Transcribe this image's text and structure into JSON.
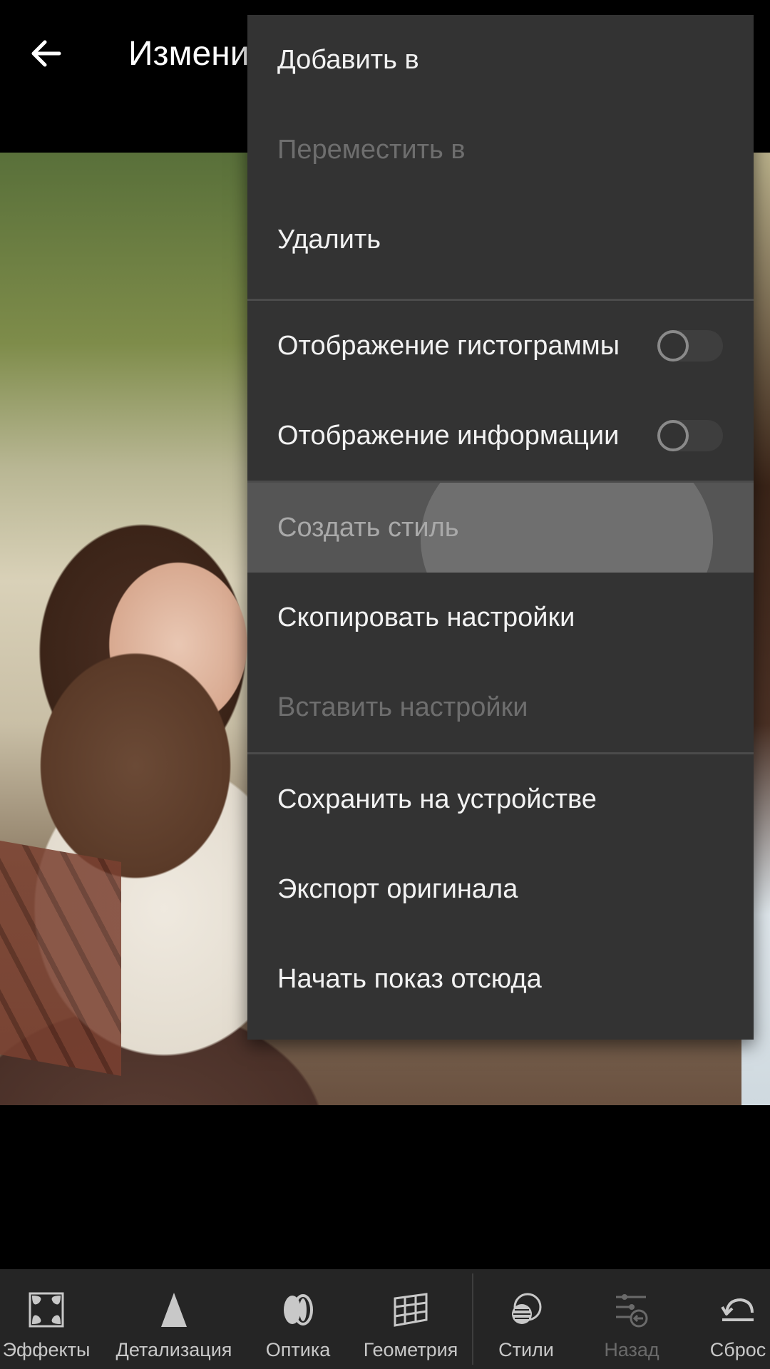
{
  "header": {
    "title": "Изменить"
  },
  "menu": {
    "items": [
      {
        "label": "Добавить в",
        "enabled": true
      },
      {
        "label": "Переместить в",
        "enabled": false
      },
      {
        "label": "Удалить",
        "enabled": true
      },
      {
        "label": "Отображение гистограммы",
        "enabled": true,
        "toggle": false
      },
      {
        "label": "Отображение информации",
        "enabled": true,
        "toggle": false
      },
      {
        "label": "Создать стиль",
        "enabled": true,
        "pressed": true
      },
      {
        "label": "Скопировать настройки",
        "enabled": true
      },
      {
        "label": "Вставить настройки",
        "enabled": false
      },
      {
        "label": "Сохранить на устройстве",
        "enabled": true
      },
      {
        "label": "Экспорт оригинала",
        "enabled": true
      },
      {
        "label": "Начать показ отсюда",
        "enabled": true
      }
    ]
  },
  "toolbar": {
    "items": [
      {
        "label": "Эффекты",
        "icon": "vignette-icon",
        "enabled": true
      },
      {
        "label": "Детализация",
        "icon": "triangle-detail-icon",
        "enabled": true
      },
      {
        "label": "Оптика",
        "icon": "lens-icon",
        "enabled": true
      },
      {
        "label": "Геометрия",
        "icon": "grid-perspective-icon",
        "enabled": true
      },
      {
        "label": "Стили",
        "icon": "presets-icon",
        "enabled": true
      },
      {
        "label": "Назад",
        "icon": "undo-sliders-icon",
        "enabled": false
      },
      {
        "label": "Сброс",
        "icon": "reset-icon",
        "enabled": true
      }
    ]
  },
  "colors": {
    "menu_bg": "#333333",
    "menu_text": "#f2f2f2",
    "menu_disabled_text": "#6e6e6e",
    "toolbar_bg": "#252525"
  }
}
